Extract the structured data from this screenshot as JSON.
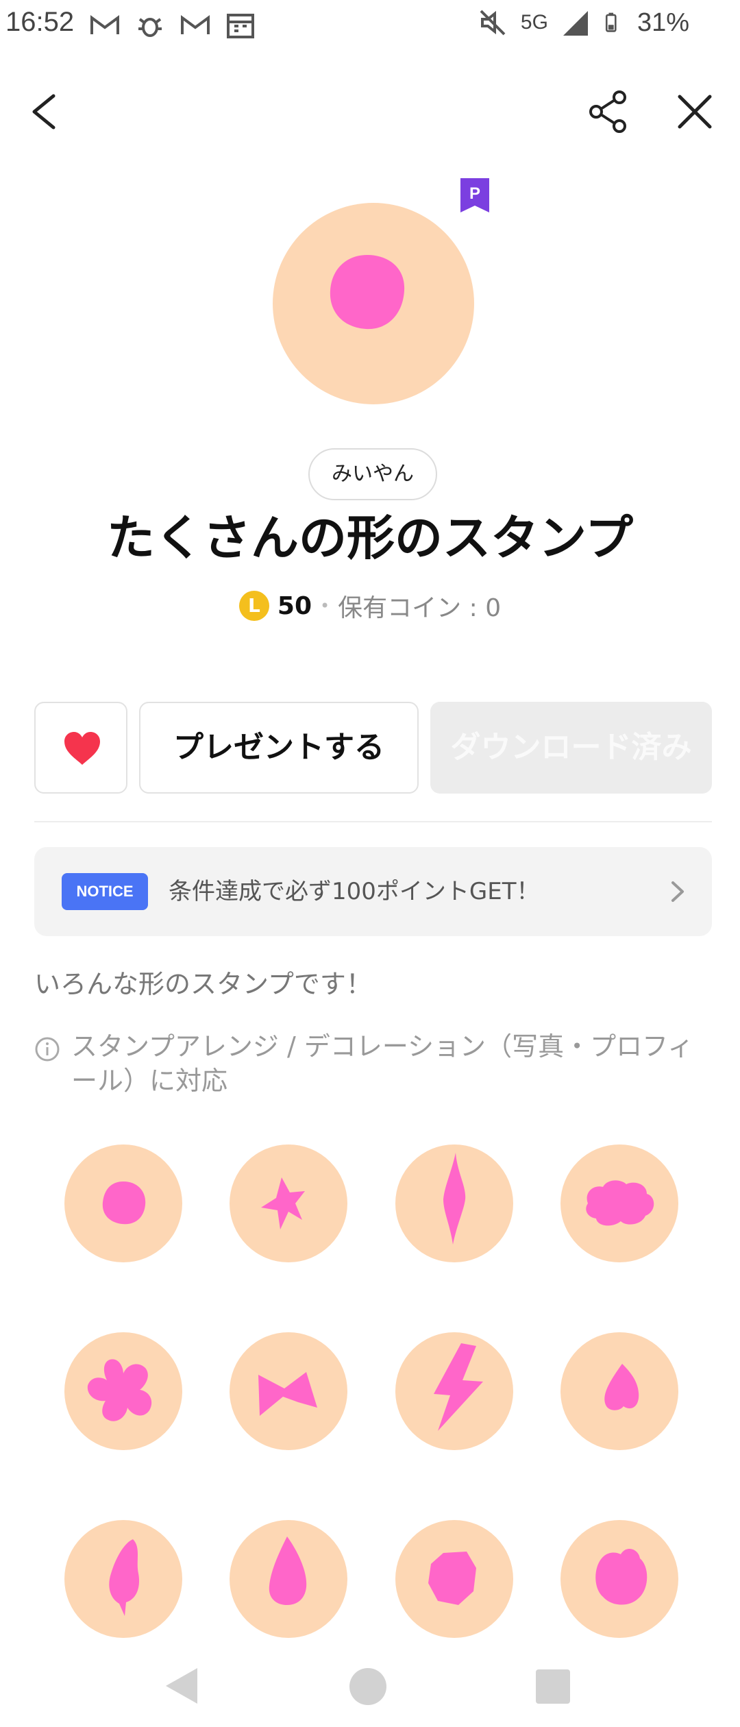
{
  "status_bar": {
    "time": "16:52",
    "network": "5G",
    "battery": "31%",
    "left_icons": [
      "gmail-icon",
      "bug-icon",
      "gmail-icon",
      "calendar-icon"
    ],
    "right_icons": [
      "mute-icon",
      "signal-icon",
      "battery-icon"
    ]
  },
  "header": {
    "back_icon": "chevron-left-icon",
    "share_icon": "share-icon",
    "close_icon": "close-icon"
  },
  "pack": {
    "premium_badge": "P",
    "author": "みいやん",
    "title": "たくさんの形のスタンプ",
    "coin_symbol": "L",
    "price": "50",
    "separator": "•",
    "owned_coins": "保有コイン : 0"
  },
  "actions": {
    "gift_label": "プレゼントする",
    "download_label": "ダウンロード済み"
  },
  "notice": {
    "badge": "NOTICE",
    "text": "条件達成で必ず100ポイントGET！"
  },
  "description": "いろんな形のスタンプです！",
  "info": "スタンプアレンジ / デコレーション（写真・プロフィール）に対応",
  "colors": {
    "sticker_bg": "#fdd7b4",
    "sticker_shape": "#ff66c9",
    "notice_badge": "#4a74f5",
    "heart": "#f5344d",
    "coin": "#f4bf1d",
    "premium": "#7b3fe0"
  },
  "stickers": [
    {
      "name": "circle"
    },
    {
      "name": "star"
    },
    {
      "name": "diamond-spike"
    },
    {
      "name": "cloud"
    },
    {
      "name": "flower"
    },
    {
      "name": "bow"
    },
    {
      "name": "lightning"
    },
    {
      "name": "heart"
    },
    {
      "name": "leaf"
    },
    {
      "name": "drop"
    },
    {
      "name": "octagon"
    },
    {
      "name": "tulip"
    }
  ]
}
